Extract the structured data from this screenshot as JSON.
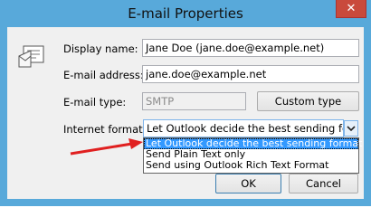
{
  "window": {
    "title": "E-mail Properties",
    "close_glyph": "✕"
  },
  "form": {
    "display_name_label": "Display name:",
    "display_name_value": "Jane Doe (jane.doe@example.net)",
    "email_address_label": "E-mail address:",
    "email_address_value": "jane.doe@example.net",
    "email_type_label": "E-mail type:",
    "email_type_value": "SMTP",
    "custom_type_label": "Custom type",
    "internet_format_label": "Internet format:",
    "internet_format_value": "Let Outlook decide the best sending format"
  },
  "dropdown": {
    "options": [
      "Let Outlook decide the best sending format",
      "Send Plain Text only",
      "Send using Outlook Rich Text Format"
    ],
    "selected_index": 0
  },
  "buttons": {
    "ok": "OK",
    "cancel": "Cancel"
  },
  "colors": {
    "window_frame": "#58a9da",
    "close_button": "#c94a3c",
    "selection": "#3399ff",
    "annotation_arrow": "#e02020"
  },
  "icons": {
    "contact_card": "contact-card-icon",
    "dropdown_arrow": "chevron-down-icon",
    "annotation": "red-arrow"
  }
}
